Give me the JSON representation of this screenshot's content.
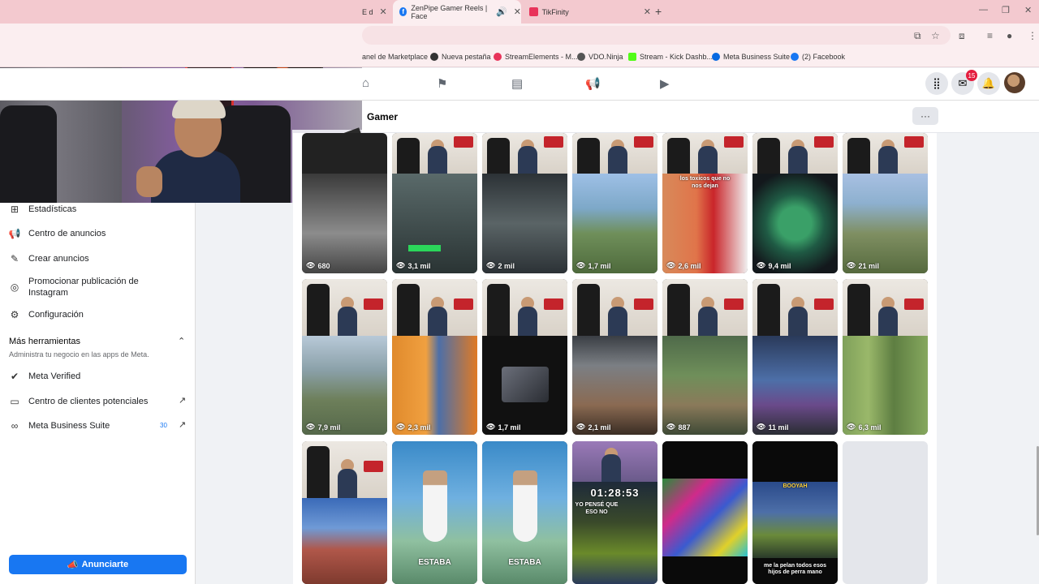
{
  "browser": {
    "tabs": [
      {
        "label": "E d",
        "active": false
      },
      {
        "label": "ZenPipe Gamer Reels | Face",
        "active": true
      },
      {
        "label": "TikFinity",
        "active": false
      }
    ],
    "bookmarks": [
      {
        "label": "anel de Marketplace",
        "icon_color": "#1877f2"
      },
      {
        "label": "Nueva pestaña",
        "icon_color": "#333333"
      },
      {
        "label": "StreamElements - M...",
        "icon_color": "#e8335a"
      },
      {
        "label": "VDO.Ninja",
        "icon_color": "#555555"
      },
      {
        "label": "Stream - Kick Dashb...",
        "icon_color": "#53fc18"
      },
      {
        "label": "Meta Business Suite",
        "icon_color": "#0668e1"
      },
      {
        "label": "(2) Facebook",
        "icon_color": "#1877f2"
      }
    ]
  },
  "fbnav": {
    "notification_count": "15"
  },
  "page": {
    "title": "Gamer",
    "more": "···"
  },
  "sidebar": {
    "items_top": [
      {
        "label": "Estadísticas",
        "icon": "chart-icon"
      },
      {
        "label": "Centro de anuncios",
        "icon": "megaphone-icon"
      },
      {
        "label": "Crear anuncios",
        "icon": "edit-icon"
      },
      {
        "label": "Promocionar publicación de Instagram",
        "icon": "instagram-icon"
      },
      {
        "label": "Configuración",
        "icon": "gear-icon"
      }
    ],
    "tools_title": "Más herramientas",
    "tools_subtitle": "Administra tu negocio en las apps de Meta.",
    "items_tools": [
      {
        "label": "Meta Verified",
        "icon": "verified-icon"
      },
      {
        "label": "Centro de clientes potenciales",
        "icon": "contacts-icon"
      },
      {
        "label": "Meta Business Suite",
        "icon": "meta-icon"
      }
    ],
    "business_suite_count": "30",
    "advertise_label": "Anunciarte"
  },
  "reels": {
    "row1": [
      "680",
      "3,1 mil",
      "2 mil",
      "1,7 mil",
      "2,6 mil",
      "9,4 mil",
      "21 mil"
    ],
    "row2": [
      "7,9 mil",
      "2,3 mil",
      "1,7 mil",
      "2,1 mil",
      "887",
      "11 mil",
      "6,3 mil"
    ],
    "overlays": {
      "toxicos": "los toxicos que no nos dejan",
      "estaba": "ESTABA",
      "timer": "01:28:53",
      "yopense": "YO PENSÉ QUE ESO NO",
      "booyah": "BOOYAH",
      "pelan": "me la pelan todos esos hijos de perra mano"
    },
    "colors": {
      "game_green": "#6f8f5a",
      "game_blue": "#4d6fa8",
      "game_orange": "#e08a2c",
      "game_dark": "#2a2d33"
    }
  }
}
